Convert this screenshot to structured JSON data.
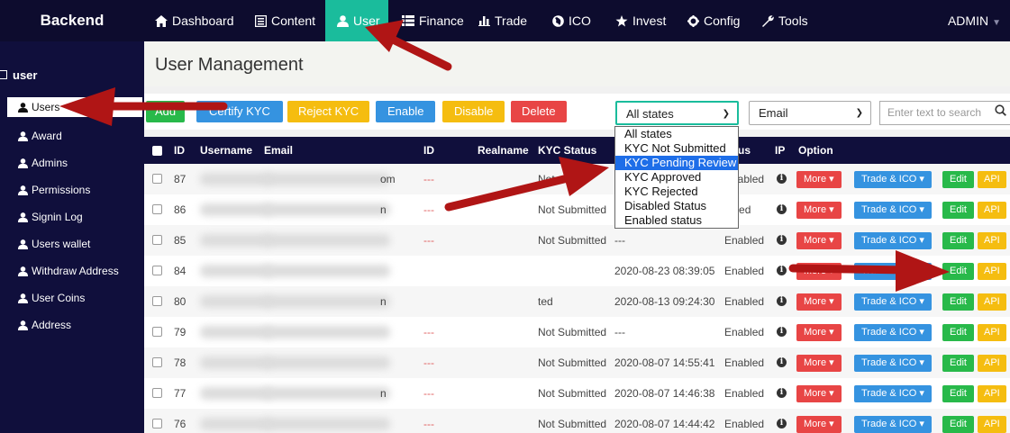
{
  "nav": {
    "brand": "Backend",
    "items": [
      {
        "label": "Dashboard",
        "icon": "home-icon"
      },
      {
        "label": "Content",
        "icon": "document-icon"
      },
      {
        "label": "User",
        "icon": "user-icon",
        "active": true
      },
      {
        "label": "Finance",
        "icon": "list-icon"
      },
      {
        "label": "Trade",
        "icon": "bar-chart-icon"
      },
      {
        "label": "ICO",
        "icon": "globe-icon"
      },
      {
        "label": "Invest",
        "icon": "star-icon"
      },
      {
        "label": "Config",
        "icon": "gear-icon"
      },
      {
        "label": "Tools",
        "icon": "wrench-icon"
      }
    ],
    "admin": "ADMIN"
  },
  "sidebar": {
    "section": "user",
    "items": [
      {
        "label": "Users",
        "active": true
      },
      {
        "label": "Award"
      },
      {
        "label": "Admins"
      },
      {
        "label": "Permissions"
      },
      {
        "label": "Signin Log"
      },
      {
        "label": "Users wallet"
      },
      {
        "label": "Withdraw Address"
      },
      {
        "label": "User Coins"
      },
      {
        "label": "Address"
      }
    ]
  },
  "page": {
    "title": "User Management"
  },
  "toolbar": {
    "add": "Add",
    "certify": "Certify KYC",
    "reject": "Reject KYC",
    "enable": "Enable",
    "disable": "Disable",
    "delete": "Delete",
    "state_select": "All states",
    "field_select": "Email",
    "search_placeholder": "Enter text to search"
  },
  "dropdown": {
    "options": [
      "All states",
      "KYC Not Submitted",
      "KYC Pending Review",
      "KYC Approved",
      "KYC Rejected",
      "Disabled Status",
      "Enabled status"
    ],
    "highlighted": 2
  },
  "table": {
    "headers": {
      "id": "ID",
      "username": "Username",
      "email": "Email",
      "id2": "ID",
      "realname": "Realname",
      "kyc": "KYC Status",
      "status": "tus",
      "ip": "IP",
      "option": "Option"
    },
    "buttons": {
      "more": "More",
      "trade": "Trade & ICO",
      "edit": "Edit",
      "api": "API"
    },
    "rows": [
      {
        "id": "87",
        "email_tail": "om",
        "id_no": "---",
        "kyc": "Not",
        "date": "",
        "status": "Enabled"
      },
      {
        "id": "86",
        "email_tail": "n",
        "id_no": "---",
        "kyc": "Not Submitted",
        "date": "",
        "status": "abled"
      },
      {
        "id": "85",
        "email_tail": "",
        "id_no": "---",
        "kyc": "Not Submitted",
        "date": "---",
        "status": "Enabled"
      },
      {
        "id": "84",
        "email_tail": "",
        "id_no": "",
        "kyc": "",
        "date": "2020-08-23 08:39:05",
        "status": "Enabled"
      },
      {
        "id": "80",
        "email_tail": "n",
        "id_no": "",
        "kyc": "ted",
        "date": "2020-08-13 09:24:30",
        "status": "Enabled"
      },
      {
        "id": "79",
        "email_tail": "",
        "id_no": "---",
        "kyc": "Not Submitted",
        "date": "---",
        "status": "Enabled"
      },
      {
        "id": "78",
        "email_tail": "",
        "id_no": "---",
        "kyc": "Not Submitted",
        "date": "2020-08-07 14:55:41",
        "status": "Enabled"
      },
      {
        "id": "77",
        "email_tail": "n",
        "id_no": "---",
        "kyc": "Not Submitted",
        "date": "2020-08-07 14:46:38",
        "status": "Enabled"
      },
      {
        "id": "76",
        "email_tail": "",
        "id_no": "---",
        "kyc": "Not Submitted",
        "date": "2020-08-07 14:44:42",
        "status": "Enabled"
      }
    ]
  },
  "colors": {
    "nav_bg": "#0d0c2e",
    "accent": "#1abc9c",
    "arrow": "#b01515"
  }
}
